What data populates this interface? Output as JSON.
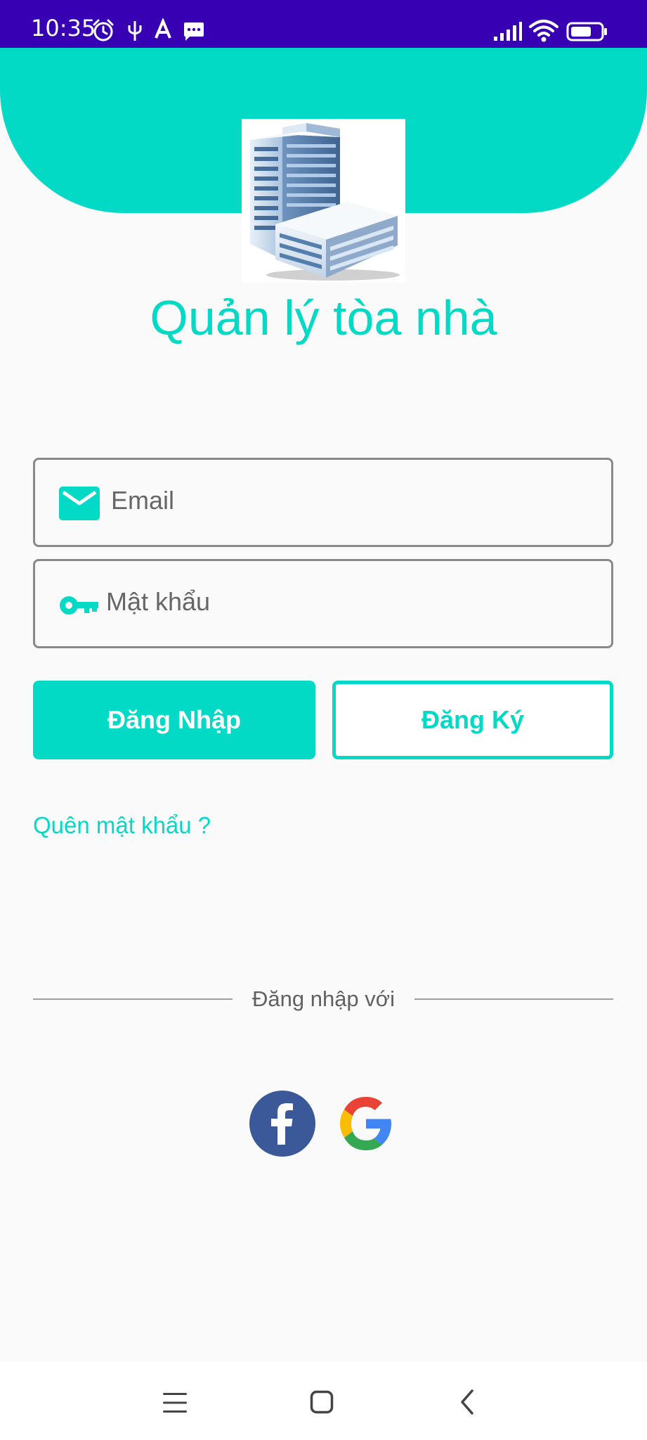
{
  "status_bar": {
    "time": "10:35",
    "left_icons": [
      "alarm-icon",
      "usb-icon",
      "a-notification-icon",
      "message-icon"
    ],
    "right_icons": [
      "signal-icon",
      "wifi-icon",
      "battery-icon"
    ]
  },
  "app": {
    "title": "Quản lý tòa nhà",
    "logo": "building-logo"
  },
  "form": {
    "email_placeholder": "Email",
    "password_placeholder": "Mật khẩu",
    "login_label": "Đăng Nhập",
    "register_label": "Đăng Ký",
    "forgot_label": "Quên mật khẩu ?"
  },
  "social": {
    "divider_label": "Đăng nhập với",
    "providers": [
      "facebook-icon",
      "google-icon"
    ]
  },
  "nav_bar": {
    "buttons": [
      "menu-icon",
      "home-icon",
      "back-icon"
    ]
  },
  "colors": {
    "status_bar": "#3700b3",
    "accent": "#03dac5",
    "background": "#fafafa",
    "facebook": "#3b5998"
  }
}
